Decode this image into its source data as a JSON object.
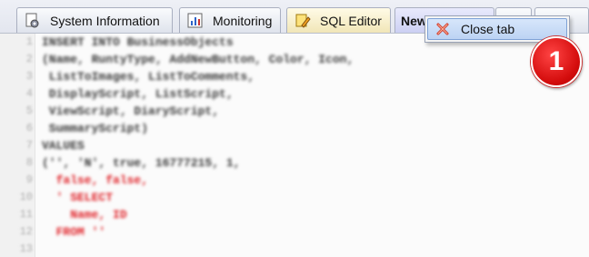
{
  "tabs": [
    {
      "label": "System Information",
      "icon": "gear-document-icon"
    },
    {
      "label": "Monitoring",
      "icon": "bar-chart-icon"
    },
    {
      "label": "SQL Editor",
      "icon": "pencil-document-icon"
    },
    {
      "label": "New",
      "icon": ""
    }
  ],
  "context_menu": {
    "close_label": "Close tab",
    "icon": "close-x-icon"
  },
  "callout": {
    "number": "1"
  },
  "editor": {
    "line_numbers": [
      "1",
      "2",
      "3",
      "4",
      "5",
      "6",
      "7",
      "8",
      "9",
      "10",
      "11",
      "12",
      "13"
    ],
    "code_lines": [
      "INSERT INTO BusinessObjects",
      "(Name, RuntyType, AddNewButton, Color, Icon,",
      " ListToImages, ListToComments,",
      " DisplayScript, ListScript,",
      " ViewScript, DiaryScript,",
      " SummaryScript)",
      "VALUES",
      "('', 'N', true, 16777215, 1,",
      "  false, false,",
      "  ' SELECT",
      "    Name, ID",
      "  FROM ''"
    ]
  },
  "colors": {
    "keyword_blue": "#3a5fd0",
    "string_red": "#e0242a",
    "callout_red": "#d40d0d"
  }
}
